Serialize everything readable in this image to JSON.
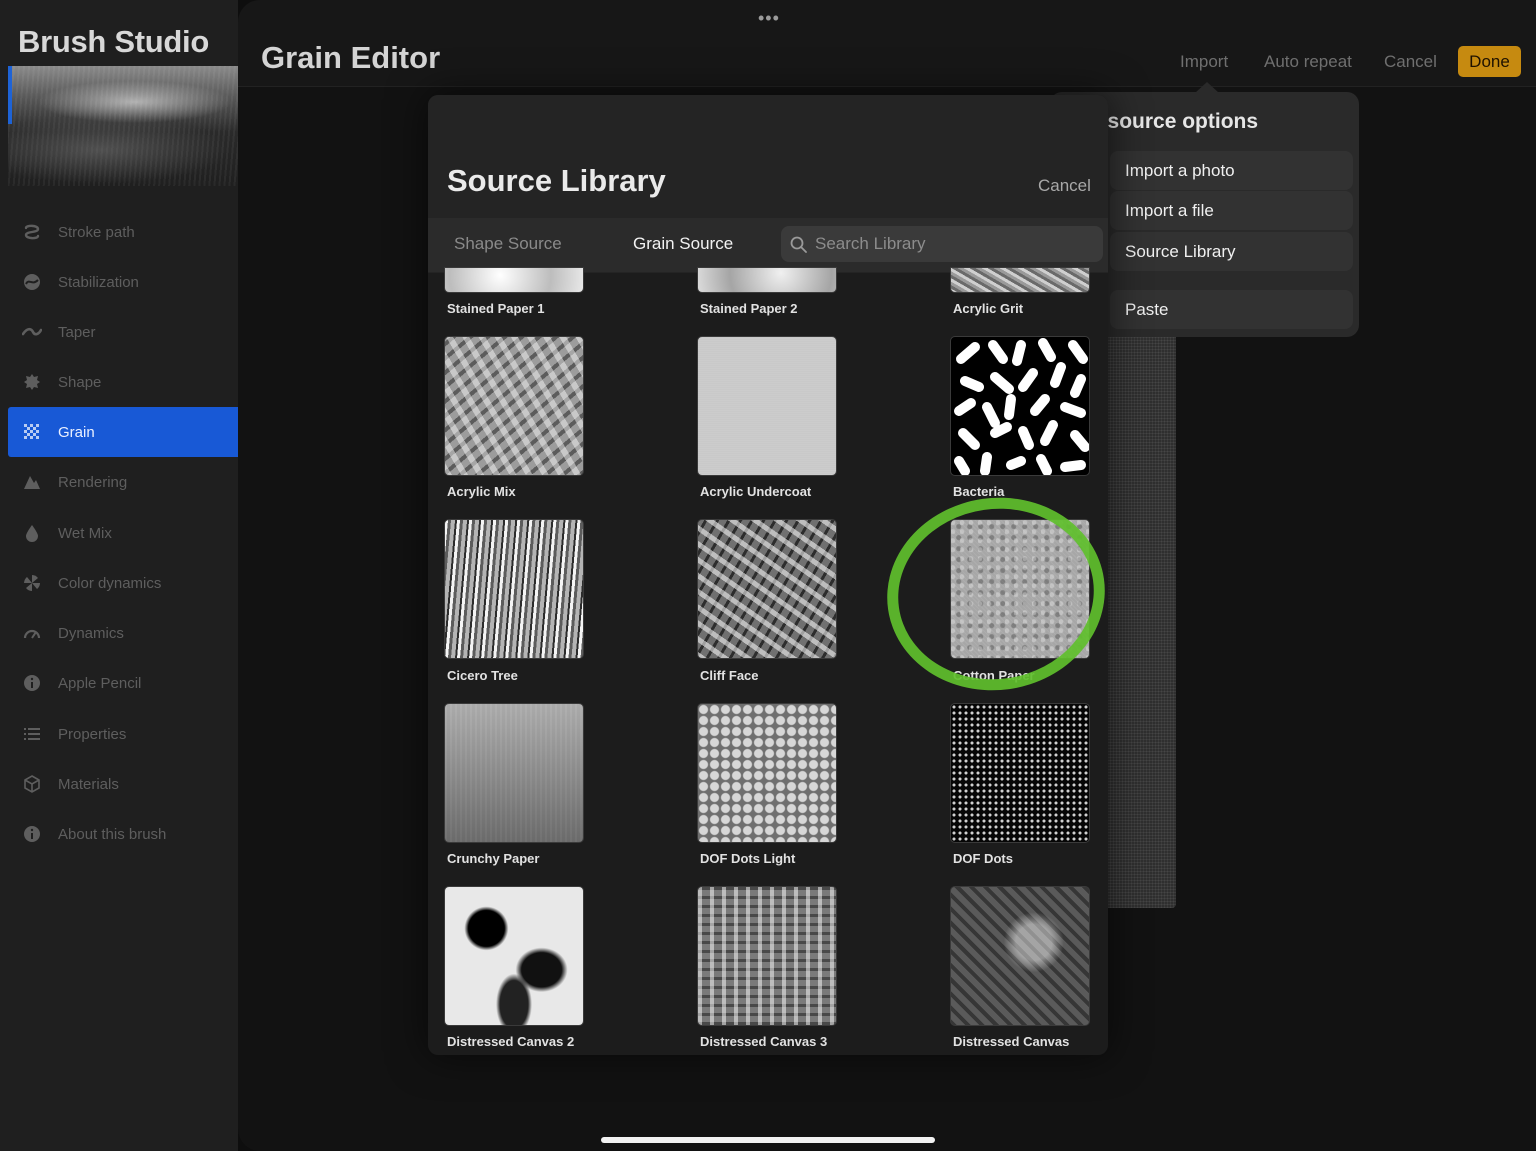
{
  "app_title": "Brush Studio",
  "editor_title": "Grain Editor",
  "grabber": "•••",
  "top_actions": {
    "import": "Import",
    "auto_repeat": "Auto repeat",
    "cancel": "Cancel",
    "done": "Done"
  },
  "sidebar": {
    "items": [
      {
        "label": "Stroke path",
        "icon": "stroke-path-icon"
      },
      {
        "label": "Stabilization",
        "icon": "stabilization-icon"
      },
      {
        "label": "Taper",
        "icon": "taper-icon"
      },
      {
        "label": "Shape",
        "icon": "shape-icon"
      },
      {
        "label": "Grain",
        "icon": "grain-icon",
        "active": true
      },
      {
        "label": "Rendering",
        "icon": "rendering-icon"
      },
      {
        "label": "Wet Mix",
        "icon": "wet-mix-icon"
      },
      {
        "label": "Color dynamics",
        "icon": "color-dynamics-icon"
      },
      {
        "label": "Dynamics",
        "icon": "dynamics-icon"
      },
      {
        "label": "Apple Pencil",
        "icon": "info-icon"
      },
      {
        "label": "Properties",
        "icon": "list-icon"
      },
      {
        "label": "Materials",
        "icon": "cube-icon"
      },
      {
        "label": "About this brush",
        "icon": "info-icon"
      }
    ]
  },
  "import_popover": {
    "title": "e source options",
    "options": [
      "Import a photo",
      "Import a file",
      "Source Library",
      "Paste"
    ]
  },
  "source_library": {
    "title": "Source Library",
    "cancel": "Cancel",
    "tabs": {
      "shape": "Shape Source",
      "grain": "Grain Source"
    },
    "search_placeholder": "Search Library",
    "items": [
      {
        "label": "Stained Paper 1"
      },
      {
        "label": "Stained Paper 2"
      },
      {
        "label": "Acrylic Grit"
      },
      {
        "label": "Acrylic Mix"
      },
      {
        "label": "Acrylic Undercoat"
      },
      {
        "label": "Bacteria"
      },
      {
        "label": "Cicero Tree"
      },
      {
        "label": "Cliff Face"
      },
      {
        "label": "Cotton Paper",
        "highlighted": true
      },
      {
        "label": "Crunchy Paper"
      },
      {
        "label": "DOF Dots Light"
      },
      {
        "label": "DOF Dots"
      },
      {
        "label": "Distressed Canvas 2"
      },
      {
        "label": "Distressed Canvas 3"
      },
      {
        "label": "Distressed Canvas"
      }
    ]
  },
  "colors": {
    "accent_blue": "#1859d6",
    "done_orange": "#c68a10",
    "highlight_green": "#5fbf2c"
  }
}
